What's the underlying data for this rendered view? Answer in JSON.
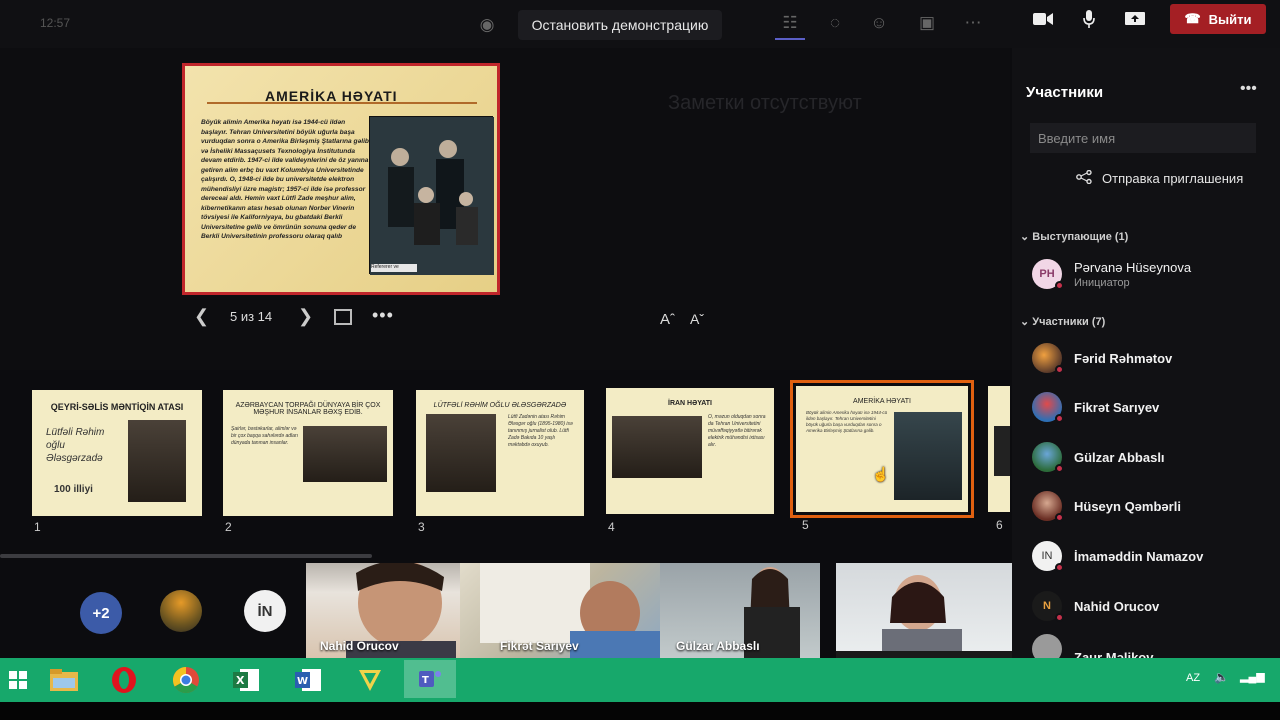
{
  "toolbar": {
    "clock": "12:57",
    "stop_presenting": "Остановить демонстрацию",
    "leave": "Выйти",
    "colors": {
      "leave_bg": "#a41f24",
      "accent": "#5b5fc7"
    }
  },
  "stage": {
    "notes_placeholder": "Заметки отсутствуют",
    "page_counter": "5 из 14",
    "font_increase": "Aˆ",
    "font_decrease": "Aˇ",
    "slide": {
      "title": "AMERİKA HƏYATI",
      "text": "Böyük alimin Amerika həyatı isə 1944-cü ildən başlayır. Tehran Universitetini böyük uğurla başa vurduqdan sonra o Amerika Birləşmiş Ştatlarına gəlib və İsheliki Massaçusets Texnologiya İnstitutunda devam etdirib. 1947-ci ilde valideynlerini de öz yanına getiren alim erbç bu vaxt Kolumbiya Universitetinde çalışırdı. O, 1948-ci ilde bu universitetde elektron mühendisliyi üzre magistr; 1957-ci ilde isə professor dereceai aldı. Hemin vaxt Lütfi Zade meşhur alim, kibernetikanın atası hesab olunan Norber Vinerin tövsiyesi ile Kaliforniyaya, bu gbatdaki Berkli Universitetine gelib ve ömrünün sonuna qeder de Berkli Universitetinin professoru olaraq qalıb",
      "caption": "Refererer ve"
    }
  },
  "thumbnails": [
    {
      "num": "1",
      "title": "QEYRİ-SƏLİS MƏNTİQİN ATASI",
      "lines": "Lütfəli Rəhim oğlu Ələsgərzadə",
      "extra": "100 illiyi"
    },
    {
      "num": "2",
      "title": "AZƏRBAYCAN TORPAĞI DÜNYAYA BİR ÇOX MƏŞHUR İNSANLAR BƏXŞ EDİB.",
      "lines": "Şairlər, bəstəkarlar, alimlər və bir çox başqa sahələrdə adları dünyada tanınan insanlar."
    },
    {
      "num": "3",
      "title": "LÜTFƏLİ RƏHİM OĞLU ƏLƏSGƏRZADƏ",
      "lines": "Lütfi Zadənin atası Rəhim Ələsgər oğlu (1895-1980) isə tanınmış jurnalist olub. Lütfi Zadə Bakıda 10 yaşlı məktəbdə oxuyub."
    },
    {
      "num": "4",
      "title": "İRAN HƏYATI",
      "lines": "O, məzun olduqdan sonra da Tehran Universitetini müvəffəqiyyətlə bitirərək elektrik mühəndisi ixtisası alır."
    },
    {
      "num": "5",
      "title": "AMERİKA HƏYATI",
      "lines": "Böyük alimin Amerika həyatı isə 1944-cü ildən başlayır. Tehran Universitetini böyük uğurla başa vurduqdan sonra o Amerika Birləşmiş Ştatlarına gəlib."
    },
    {
      "num": "6",
      "title": "",
      "lines": ""
    }
  ],
  "videos": {
    "overflow_count": "+2",
    "avatar_initials": "İN",
    "tiles": [
      {
        "name": "Nahid Orucov"
      },
      {
        "name": "Fikrət Sarıyev"
      },
      {
        "name": "Gülzar Abbaslı"
      },
      {
        "name": ""
      }
    ]
  },
  "panel": {
    "title": "Участники",
    "search_placeholder": "Введите имя",
    "invite": "Отправка приглашения",
    "presenters_header": "Выступающие (1)",
    "presenter": {
      "initials": "PH",
      "name": "Pərvanə Hüseynova",
      "role": "Инициатор"
    },
    "attendees_header": "Участники (7)",
    "attendees": [
      {
        "name": "Fərid Rəhmətov",
        "initials": ""
      },
      {
        "name": "Fikrət Sarıyev",
        "initials": ""
      },
      {
        "name": "Gülzar Abbaslı",
        "initials": ""
      },
      {
        "name": "Hüseyn Qəmbərli",
        "initials": ""
      },
      {
        "name": "İmaməddin Namazov",
        "initials": "IN"
      },
      {
        "name": "Nahid Orucov",
        "initials": "N"
      },
      {
        "name": "Zaur Məlikov",
        "initials": ""
      }
    ]
  },
  "taskbar": {
    "language": "AZ",
    "apps": [
      "file-explorer",
      "opera",
      "chrome",
      "excel",
      "word",
      "vim",
      "teams"
    ]
  }
}
